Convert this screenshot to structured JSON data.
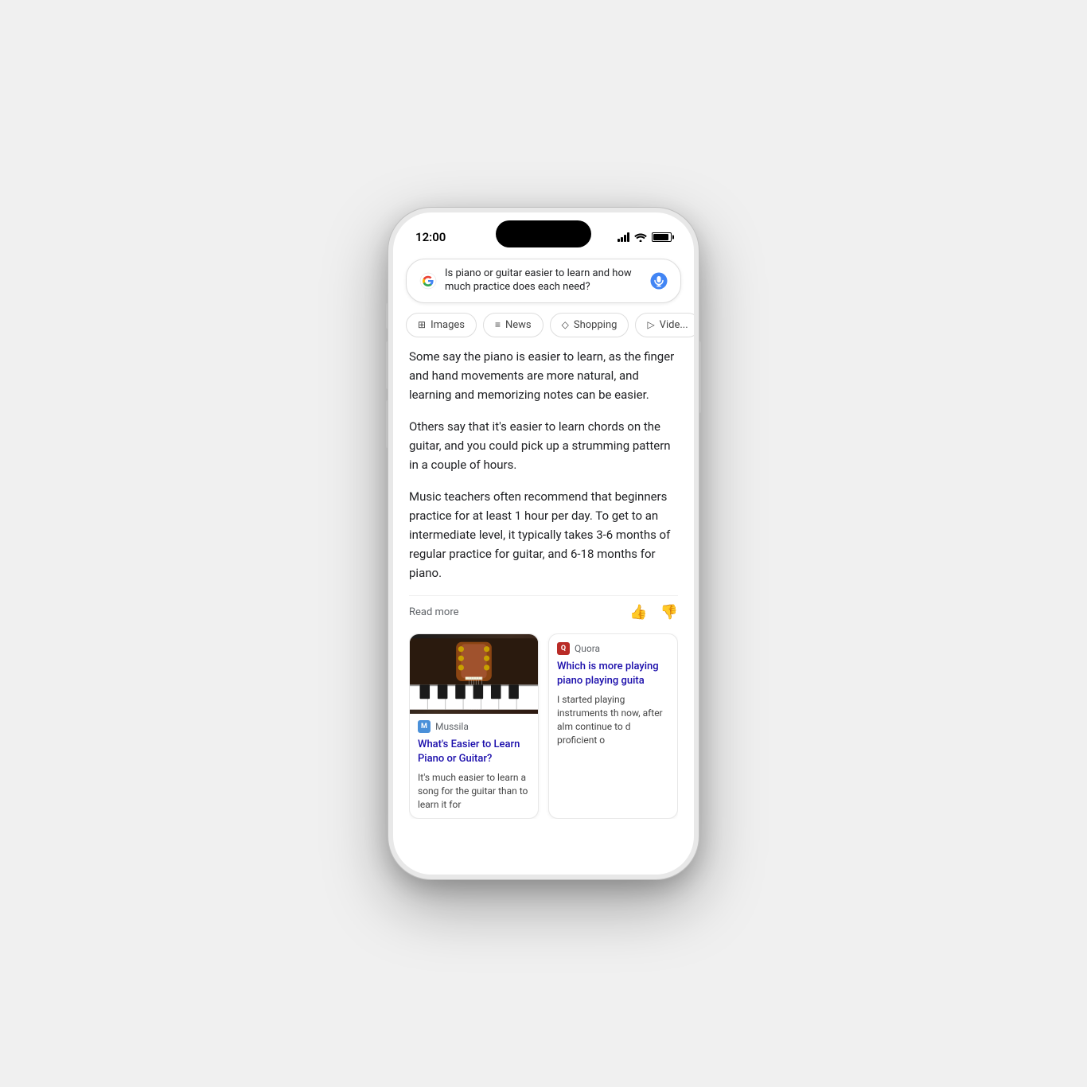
{
  "phone": {
    "time": "12:00"
  },
  "search": {
    "query": "Is piano or guitar easier to learn and how much practice does each need?"
  },
  "tabs": [
    {
      "label": "Images",
      "icon": "🖼"
    },
    {
      "label": "News",
      "icon": "📰"
    },
    {
      "label": "Shopping",
      "icon": "🛍"
    },
    {
      "label": "Vide...",
      "icon": "▶"
    }
  ],
  "answer": {
    "paragraph1": "Some say the piano is easier to learn, as the finger and hand movements are more natural, and learning and memorizing notes can be easier.",
    "paragraph2": "Others say that it's easier to learn chords on the guitar, and you could pick up a strumming pattern in a couple of hours.",
    "paragraph3": "Music teachers often recommend that beginners practice for at least 1 hour per day. To get to an intermediate level, it typically takes 3-6 months of regular practice for guitar, and 6-18 months for piano.",
    "read_more": "Read more"
  },
  "cards": [
    {
      "source": "Mussila",
      "title": "What's Easier to Learn Piano or Guitar?",
      "snippet": "It's much easier to learn a song for the guitar than to learn it for"
    },
    {
      "source": "Quora",
      "title": "Which is more playing piano playing guita",
      "snippet": "I started playing instruments th now, after alm continue to d proficient o"
    }
  ]
}
